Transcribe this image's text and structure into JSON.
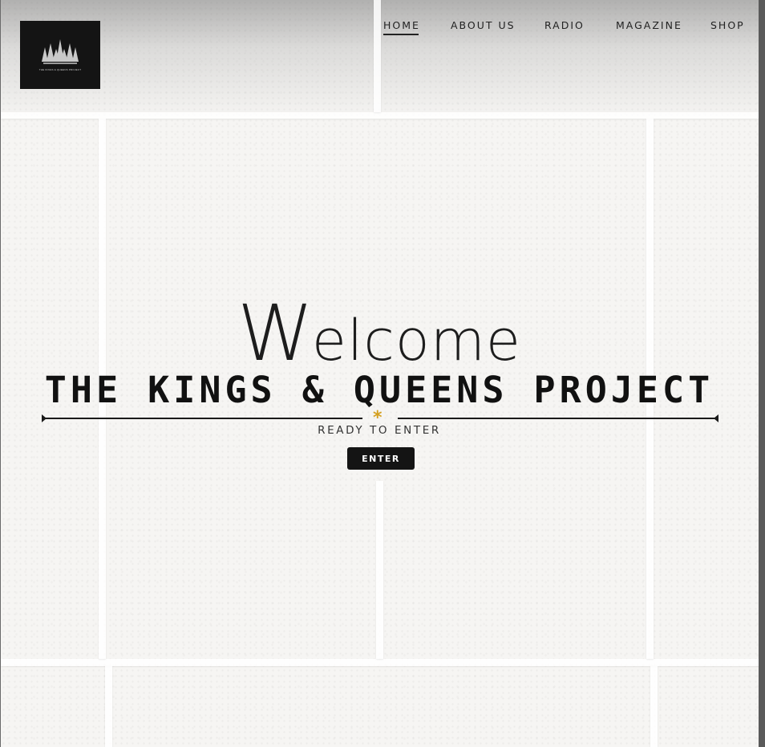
{
  "logo": {
    "text": "THE KINGS & QUEENS PROJECT"
  },
  "nav": {
    "items": [
      {
        "label": "HOME",
        "active": true
      },
      {
        "label": "ABOUT US",
        "active": false
      },
      {
        "label": "RADIO",
        "active": false
      },
      {
        "label": "MAGAZINE",
        "active": false
      },
      {
        "label": "SHOP",
        "active": false
      }
    ]
  },
  "hero": {
    "welcome_initial": "W",
    "welcome_rest": "elcome",
    "title": "THE KINGS & QUEENS PROJECT",
    "tagline": "READY TO ENTER",
    "enter_label": "ENTER",
    "ornament": "*"
  },
  "colors": {
    "accent": "#d4a020",
    "dark": "#141414",
    "background": "#f6f5f3"
  }
}
